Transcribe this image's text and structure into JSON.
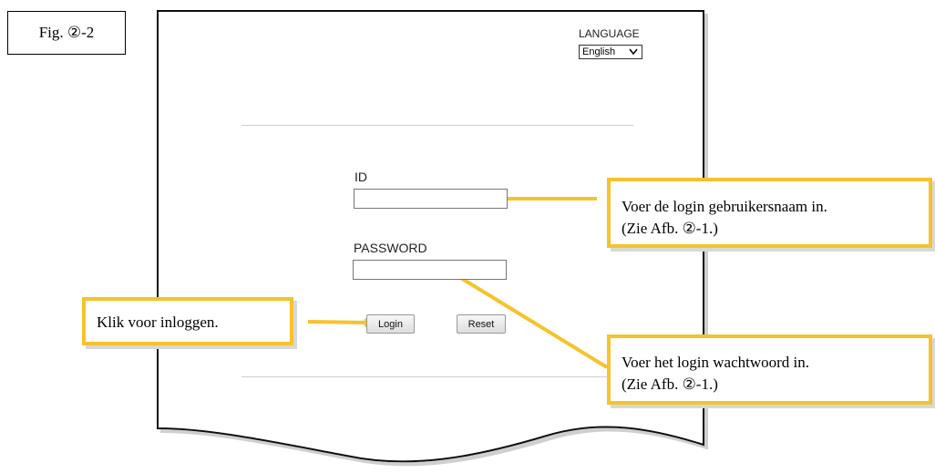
{
  "figure": {
    "label": "Fig. ②-2"
  },
  "language": {
    "label": "LANGUAGE",
    "selected": "English"
  },
  "form": {
    "id_label": "ID",
    "id_value": "",
    "password_label": "PASSWORD",
    "password_value": "",
    "login_button": "Login",
    "reset_button": "Reset"
  },
  "callouts": {
    "id_line1": "Voer de login gebruikersnaam in.",
    "id_line2": "(Zie Afb. ②-1.)",
    "password_line1": "Voer het login wachtwoord in.",
    "password_line2": "(Zie Afb. ②-1.)",
    "login": "Klik voor inloggen."
  },
  "colors": {
    "callout_border": "#f5c32c",
    "connector": "#f5c32c",
    "page_border": "#111111"
  },
  "icons": {
    "select_arrow": "chevron-down-icon"
  }
}
